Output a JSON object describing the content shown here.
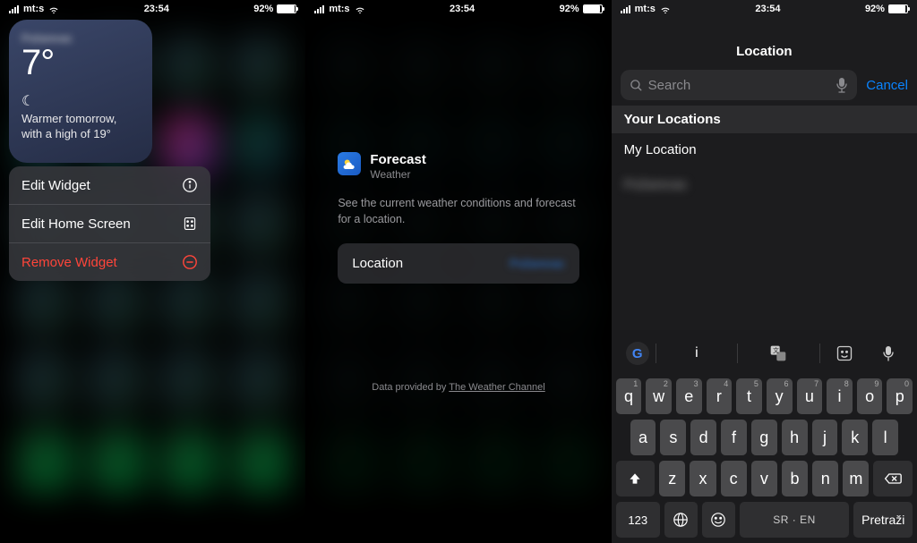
{
  "status": {
    "carrier": "mt:s",
    "time": "23:54",
    "battery_pct": "92%",
    "battery_fill": 92
  },
  "s1": {
    "widget": {
      "location": "Požarevac",
      "temp": "7°",
      "moon_glyph": "☾",
      "summary": "Warmer tomorrow, with a high of 19°"
    },
    "menu": {
      "edit_widget": "Edit Widget",
      "edit_home": "Edit Home Screen",
      "remove": "Remove Widget"
    }
  },
  "s2": {
    "title": "Forecast",
    "subtitle": "Weather",
    "description": "See the current weather conditions and forecast for a location.",
    "location_label": "Location",
    "location_value": "Požarevac",
    "credit_prefix": "Data provided by ",
    "credit_link": "The Weather Channel"
  },
  "s3": {
    "title": "Location",
    "search_placeholder": "Search",
    "cancel": "Cancel",
    "section": "Your Locations",
    "items": [
      "My Location",
      "Požarevac"
    ],
    "keyboard": {
      "row1": [
        "q",
        "w",
        "e",
        "r",
        "t",
        "y",
        "u",
        "i",
        "o",
        "p"
      ],
      "hints1": [
        "1",
        "2",
        "3",
        "4",
        "5",
        "6",
        "7",
        "8",
        "9",
        "0"
      ],
      "row2": [
        "a",
        "s",
        "d",
        "f",
        "g",
        "h",
        "j",
        "k",
        "l"
      ],
      "row3": [
        "z",
        "x",
        "c",
        "v",
        "b",
        "n",
        "m"
      ],
      "num_key": "123",
      "lang": "SR · EN",
      "search": "Pretraži",
      "sug_letter": "i"
    }
  }
}
